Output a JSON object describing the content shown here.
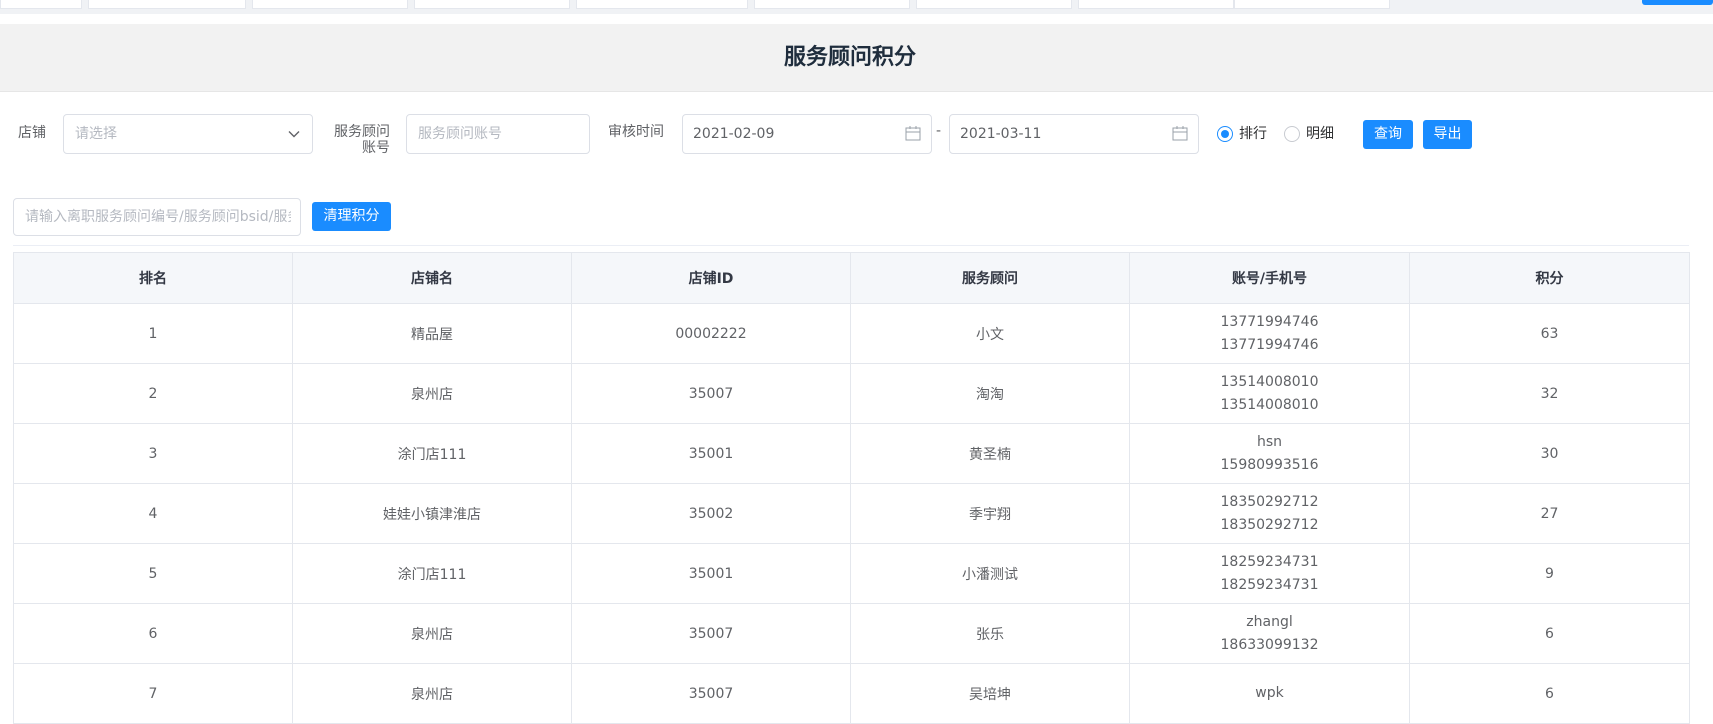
{
  "page": {
    "title": "服务顾问积分"
  },
  "filters": {
    "store_label": "店铺",
    "store_placeholder": "请选择",
    "account_label_line1": "服务顾问",
    "account_label_line2": "账号",
    "account_placeholder": "服务顾问账号",
    "audit_time_label": "审核时间",
    "date_start": "2021-02-09",
    "date_sep": "-",
    "date_end": "2021-03-11",
    "radio_rank_label": "排行",
    "radio_detail_label": "明细",
    "radio_selected": "排行",
    "query_button": "查询",
    "export_button": "导出"
  },
  "clear": {
    "search_placeholder": "请输入离职服务顾问编号/服务顾问bsid/服务顾问账号",
    "clear_button": "清理积分"
  },
  "table": {
    "columns": [
      "排名",
      "店铺名",
      "店铺ID",
      "服务顾问",
      "账号/手机号",
      "积分"
    ],
    "rows": [
      {
        "rank": "1",
        "store": "精品屋",
        "store_id": "00002222",
        "advisor": "小文",
        "account": "13771994746",
        "phone": "13771994746",
        "points": "63"
      },
      {
        "rank": "2",
        "store": "泉州店",
        "store_id": "35007",
        "advisor": "淘淘",
        "account": "13514008010",
        "phone": "13514008010",
        "points": "32"
      },
      {
        "rank": "3",
        "store": "涂门店111",
        "store_id": "35001",
        "advisor": "黄圣楠",
        "account": "hsn",
        "phone": "15980993516",
        "points": "30"
      },
      {
        "rank": "4",
        "store": "娃娃小镇津淮店",
        "store_id": "35002",
        "advisor": "季宇翔",
        "account": "18350292712",
        "phone": "18350292712",
        "points": "27"
      },
      {
        "rank": "5",
        "store": "涂门店111",
        "store_id": "35001",
        "advisor": "小潘测试",
        "account": "18259234731",
        "phone": "18259234731",
        "points": "9"
      },
      {
        "rank": "6",
        "store": "泉州店",
        "store_id": "35007",
        "advisor": "张乐",
        "account": "zhangl",
        "phone": "18633099132",
        "points": "6"
      },
      {
        "rank": "7",
        "store": "泉州店",
        "store_id": "35007",
        "advisor": "吴培坤",
        "account": "wpk",
        "phone": "",
        "points": "6"
      }
    ]
  },
  "colors": {
    "primary": "#1a8cff",
    "title_bg": "#f2f2f2",
    "header_bg": "#f5f7fa"
  }
}
